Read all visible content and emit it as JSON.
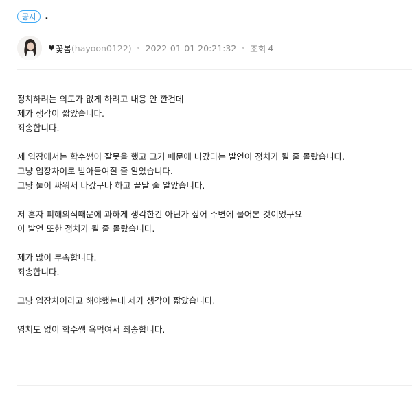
{
  "post": {
    "badge": "공지",
    "title": ".",
    "author": {
      "nickname": "꽃봄",
      "user_id": "(hayoon0122)",
      "heart_icon": "♥"
    },
    "date": "2022-01-01 20:21:32",
    "views_label": "조회",
    "views_count": "4",
    "separator": "•"
  },
  "content": {
    "paragraphs": [
      [
        "정치하려는 의도가 없게 하려고 내용 안 깐건데",
        "제가 생각이 짧았습니다.",
        "죄송합니다."
      ],
      [
        "제 입장에서는 학수쌤이 잘못을 했고 그거 때문에 나갔다는 발언이 정치가 될 줄 몰랐습니다.",
        "그냥 입장차이로 받아들여질 줄 알았습니다.",
        "그냥 둘이 싸워서 나갔구나 하고 끝날 줄 알았습니다."
      ],
      [
        "저 혼자 피해의식때문에 과하게 생각한건 아닌가 싶어 주변에 물어본 것이었구요",
        "이 발언 또한 정치가 될 줄 몰랐습니다."
      ],
      [
        "제가 많이 부족합니다.",
        "죄송합니다."
      ],
      [
        "그냥 입장차이라고 해야했는데 제가 생각이 짧았습니다."
      ],
      [
        "염치도 없이 학수쌤 욕먹여서 죄송합니다."
      ]
    ]
  },
  "colors": {
    "badge_border": "#3fa9f5",
    "badge_text": "#2a8fdc",
    "meta_text": "#8a8a8a",
    "divider": "#eeeeee"
  }
}
